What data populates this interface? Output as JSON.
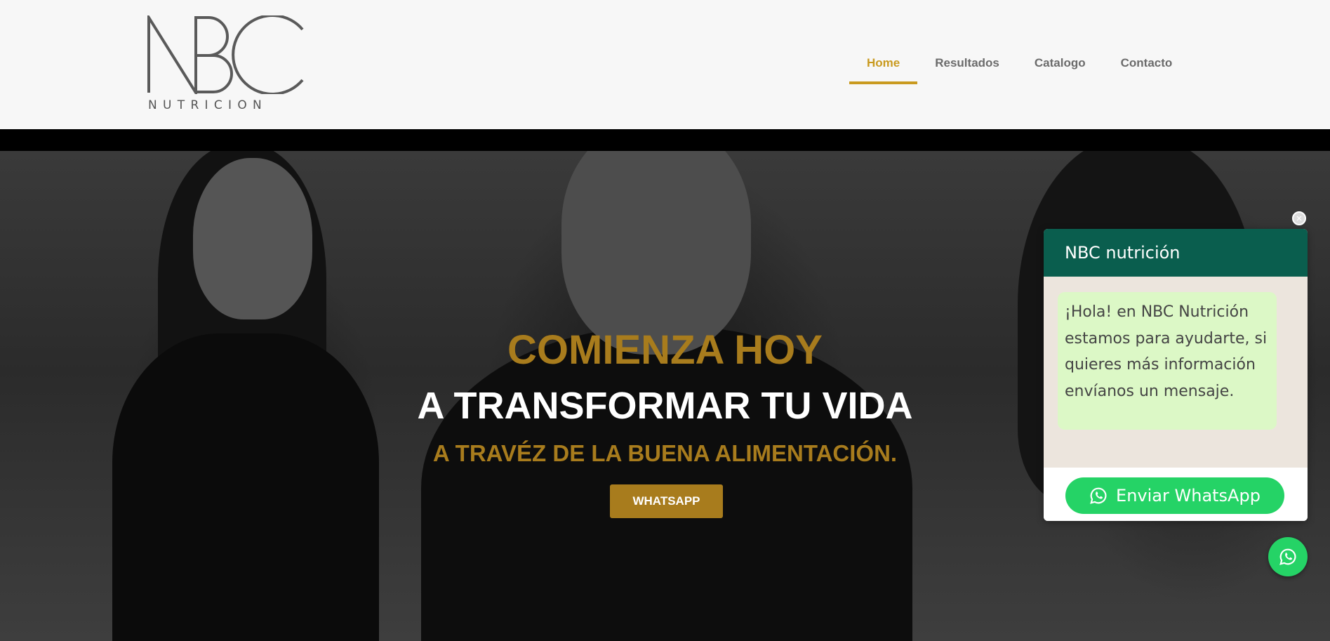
{
  "brand": {
    "logo_letters": "NBC",
    "logo_sub": "NUTRICION",
    "logo_color": "#5a5a5a"
  },
  "nav": {
    "items": [
      {
        "label": "Home",
        "active": true
      },
      {
        "label": "Resultados",
        "active": false
      },
      {
        "label": "Catalogo",
        "active": false
      },
      {
        "label": "Contacto",
        "active": false
      }
    ],
    "accent": "#c99a1f"
  },
  "hero": {
    "line1": "COMIENZA HOY",
    "line2": "A TRANSFORMAR TU VIDA",
    "line3": "A TRAVÉZ DE LA BUENA ALIMENTACIÓN.",
    "button_label": "WHATSAPP",
    "accent": "#a87c1d"
  },
  "chat": {
    "title": "NBC nutrición",
    "message": "¡Hola! en NBC Nutrición estamos para ayudarte, si quieres más información envíanos un mensaje.",
    "send_label": "Enviar WhatsApp",
    "close_icon": "close-icon",
    "header_color": "#0a5e4e",
    "button_color": "#25d366"
  },
  "fab": {
    "icon": "whatsapp-icon"
  }
}
